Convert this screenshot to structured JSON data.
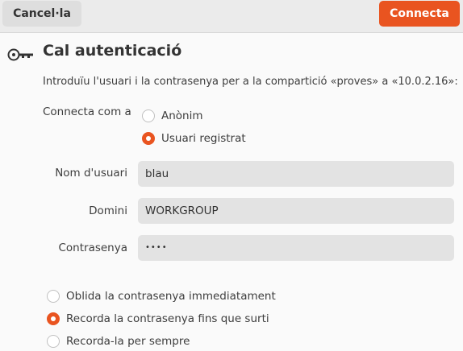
{
  "header": {
    "cancel_label": "Cancel·la",
    "connect_label": "Connecta",
    "accent_color": "#e95420"
  },
  "dialog": {
    "icon": "key-icon",
    "title": "Cal autenticació",
    "description": "Introduïu l'usuari i la contrasenya per a la compartició «proves» a «10.0.2.16»:",
    "connect_as": {
      "label": "Connecta com a",
      "options": [
        {
          "label": "Anònim",
          "selected": false
        },
        {
          "label": "Usuari registrat",
          "selected": true
        }
      ]
    },
    "fields": {
      "username": {
        "label": "Nom d'usuari",
        "value": "blau"
      },
      "domain": {
        "label": "Domini",
        "value": "WORKGROUP"
      },
      "password": {
        "label": "Contrasenya",
        "value": "••••"
      }
    },
    "remember": {
      "options": [
        {
          "label": "Oblida la contrasenya immediatament",
          "selected": false
        },
        {
          "label": "Recorda la contrasenya fins que surti",
          "selected": true
        },
        {
          "label": "Recorda-la per sempre",
          "selected": false
        }
      ]
    }
  }
}
